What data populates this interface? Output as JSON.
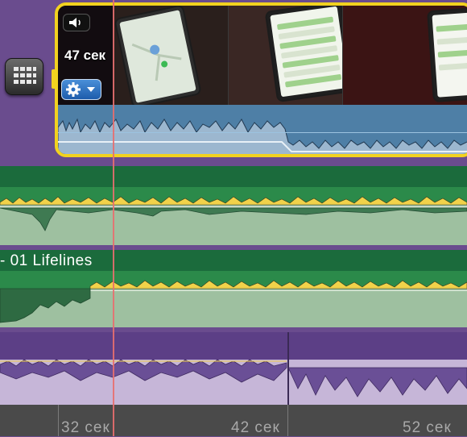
{
  "clip": {
    "duration_label": "47 сек",
    "volume_icon": "speaker-icon",
    "settings_icon": "gear-icon"
  },
  "music": {
    "track_title": "- 01 Lifelines"
  },
  "ruler": {
    "labels": [
      "32 сек",
      "42 сек",
      "52 сек"
    ]
  },
  "colors": {
    "clip_border": "#f2d21f",
    "music_track": "#2b8a4a",
    "voice_track": "#5c3f86",
    "playhead": "#e86f6f"
  }
}
